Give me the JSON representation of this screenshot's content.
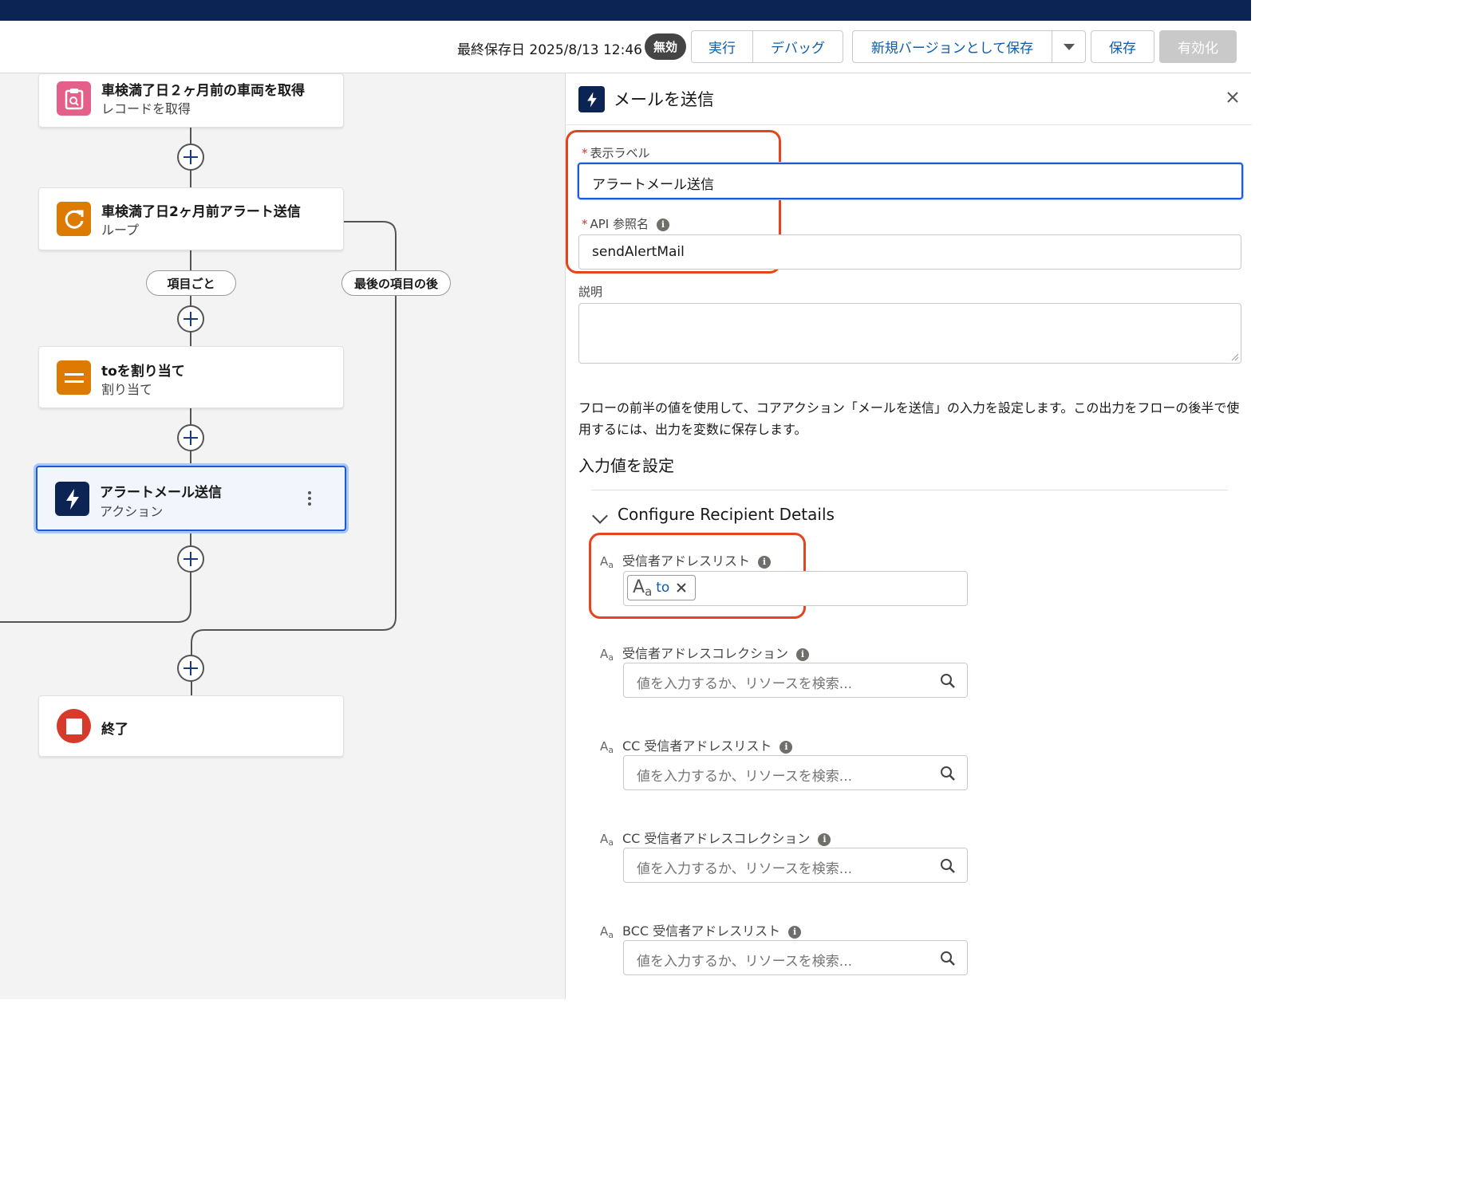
{
  "toolbar": {
    "saved_text": "最終保存日 2025/8/13 12:46",
    "status_badge": "無効",
    "run_label": "実行",
    "debug_label": "デバッグ",
    "save_as_new_label": "新規バージョンとして保存",
    "save_label": "保存",
    "activate_label": "有効化"
  },
  "flow": {
    "nodes": [
      {
        "title": "車検満了日２ヶ月前の車両を取得",
        "subtitle": "レコードを取得",
        "icon": "get-records-icon",
        "color": "#e3608a"
      },
      {
        "title": "車検満了日2ヶ月前アラート送信",
        "subtitle": "ループ",
        "icon": "loop-icon",
        "color": "#dd7a01"
      },
      {
        "title": "toを割り当て",
        "subtitle": "割り当て",
        "icon": "assignment-icon",
        "color": "#dd7a01"
      },
      {
        "title": "アラートメール送信",
        "subtitle": "アクション",
        "icon": "action-icon",
        "color": "#0b2453"
      },
      {
        "title": "終了",
        "subtitle": "",
        "icon": "end-icon",
        "color": "#d63a2b"
      }
    ],
    "for_each_label": "項目ごと",
    "after_last_label": "最後の項目の後"
  },
  "panel": {
    "title": "メールを送信",
    "label_field_label": "表示ラベル",
    "label_field_value": "アラートメール送信",
    "api_field_label": "API 参照名",
    "api_field_value": "sendAlertMail",
    "description_label": "説明",
    "description_value": "",
    "help_text": "フローの前半の値を使用して、コアアクション「メールを送信」の入力を設定します。この出力をフローの後半で使用するには、出力を変数に保存します。",
    "section_title": "入力値を設定",
    "subsection_title": "Configure Recipient Details",
    "type_icon_text": "A",
    "type_icon_sub": "a",
    "fields": [
      {
        "label": "受信者アドレスリスト",
        "chip": "to"
      },
      {
        "label": "受信者アドレスコレクション",
        "placeholder": "値を入力するか、リソースを検索..."
      },
      {
        "label": "CC 受信者アドレスリスト",
        "placeholder": "値を入力するか、リソースを検索..."
      },
      {
        "label": "CC 受信者アドレスコレクション",
        "placeholder": "値を入力するか、リソースを検索..."
      },
      {
        "label": "BCC 受信者アドレスリスト",
        "placeholder": "値を入力するか、リソースを検索..."
      }
    ]
  },
  "colors": {
    "accent": "#0b5cab",
    "highlight": "#e3461f",
    "topbar": "#0b2453"
  }
}
